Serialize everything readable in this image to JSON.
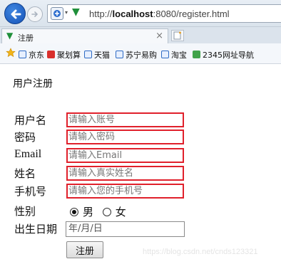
{
  "browser": {
    "url_prefix": "http://",
    "url_host": "localhost",
    "url_rest": ":8080/register.html",
    "tab_title": "注册",
    "tab_close": "×",
    "favorites": [
      "京东",
      "聚划算",
      "天猫",
      "苏宁易购",
      "淘宝",
      "2345网址导航"
    ]
  },
  "form": {
    "heading": "用户注册",
    "fields": [
      {
        "label": "用户名",
        "placeholder": "请输入账号"
      },
      {
        "label": "密码",
        "placeholder": "请输入密码"
      },
      {
        "label": "Email",
        "placeholder": "请输入Email"
      },
      {
        "label": "姓名",
        "placeholder": "请输入真实姓名"
      },
      {
        "label": "手机号",
        "placeholder": "请输入您的手机号"
      }
    ],
    "gender": {
      "label": "性别",
      "options": [
        "男",
        "女"
      ],
      "selected": "男"
    },
    "birthday": {
      "label": "出生日期",
      "placeholder": "年/月/日"
    },
    "submit_label": "注册"
  },
  "watermark": "https://blog.csdn.net/cnds123321",
  "colors": {
    "field_border": "#e0202b",
    "accent_green": "#1f8f3a"
  }
}
